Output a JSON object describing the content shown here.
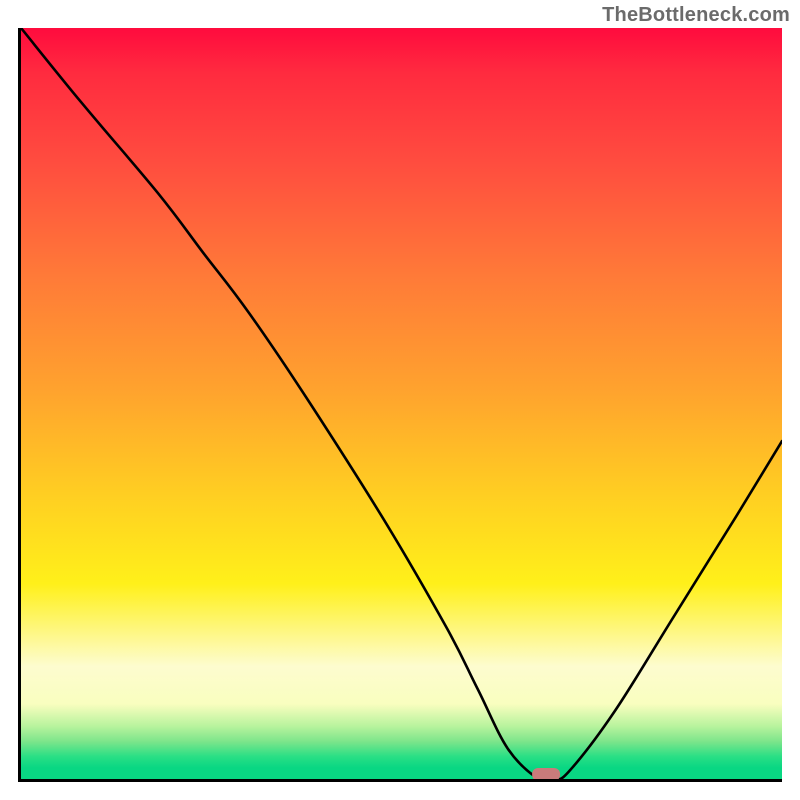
{
  "watermark": "TheBottleneck.com",
  "chart_data": {
    "type": "line",
    "title": "",
    "xlabel": "",
    "ylabel": "",
    "xlim": [
      0,
      100
    ],
    "ylim": [
      0,
      100
    ],
    "grid": false,
    "legend": false,
    "series": [
      {
        "name": "bottleneck-curve",
        "x": [
          0,
          8,
          18,
          24,
          30,
          38,
          48,
          56,
          60,
          64,
          68,
          70,
          72,
          78,
          86,
          94,
          100
        ],
        "values": [
          100,
          90,
          78,
          70,
          62,
          50,
          34,
          20,
          12,
          4,
          0,
          0,
          1,
          9,
          22,
          35,
          45
        ]
      }
    ],
    "marker": {
      "name": "optimal-point",
      "x": 69,
      "y": 0,
      "color": "#c97b7b",
      "shape": "rounded-rect"
    },
    "gradient": {
      "direction": "vertical",
      "stops": [
        {
          "pos": 0,
          "color": "#ff0b3e"
        },
        {
          "pos": 0.33,
          "color": "#ff7a38"
        },
        {
          "pos": 0.62,
          "color": "#ffce22"
        },
        {
          "pos": 0.85,
          "color": "#fdfccf"
        },
        {
          "pos": 0.97,
          "color": "#2adf85"
        },
        {
          "pos": 1.0,
          "color": "#09d783"
        }
      ]
    }
  }
}
